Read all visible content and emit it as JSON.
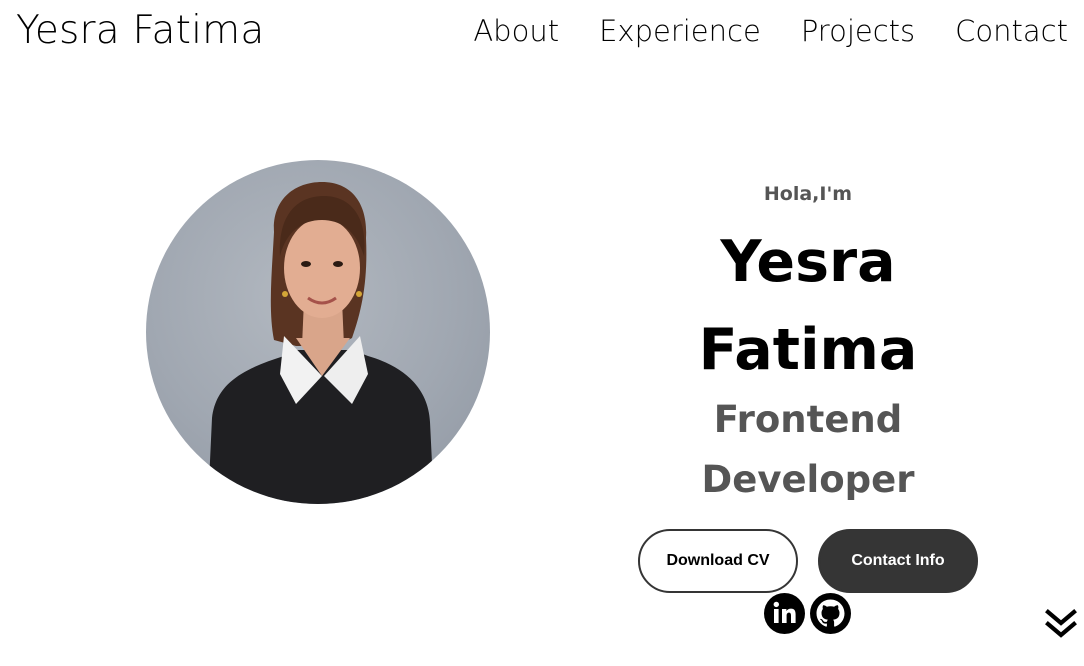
{
  "header": {
    "logo": "Yesra Fatima",
    "nav": [
      "About",
      "Experience",
      "Projects",
      "Contact"
    ]
  },
  "hero": {
    "greeting": "Hola,I'm",
    "name_line1": "Yesra",
    "name_line2": "Fatima",
    "role_line1": "Frontend",
    "role_line2": "Developer",
    "buttons": {
      "download_cv": "Download CV",
      "contact_info": "Contact Info"
    },
    "social_icons": [
      "linkedin-icon",
      "github-icon"
    ],
    "scroll_icon": "double-chevron-down-icon"
  },
  "colors": {
    "text": "#000000",
    "muted_text": "#555555",
    "button_dark": "#353535",
    "avatar_bg": "#a0a7b1"
  }
}
